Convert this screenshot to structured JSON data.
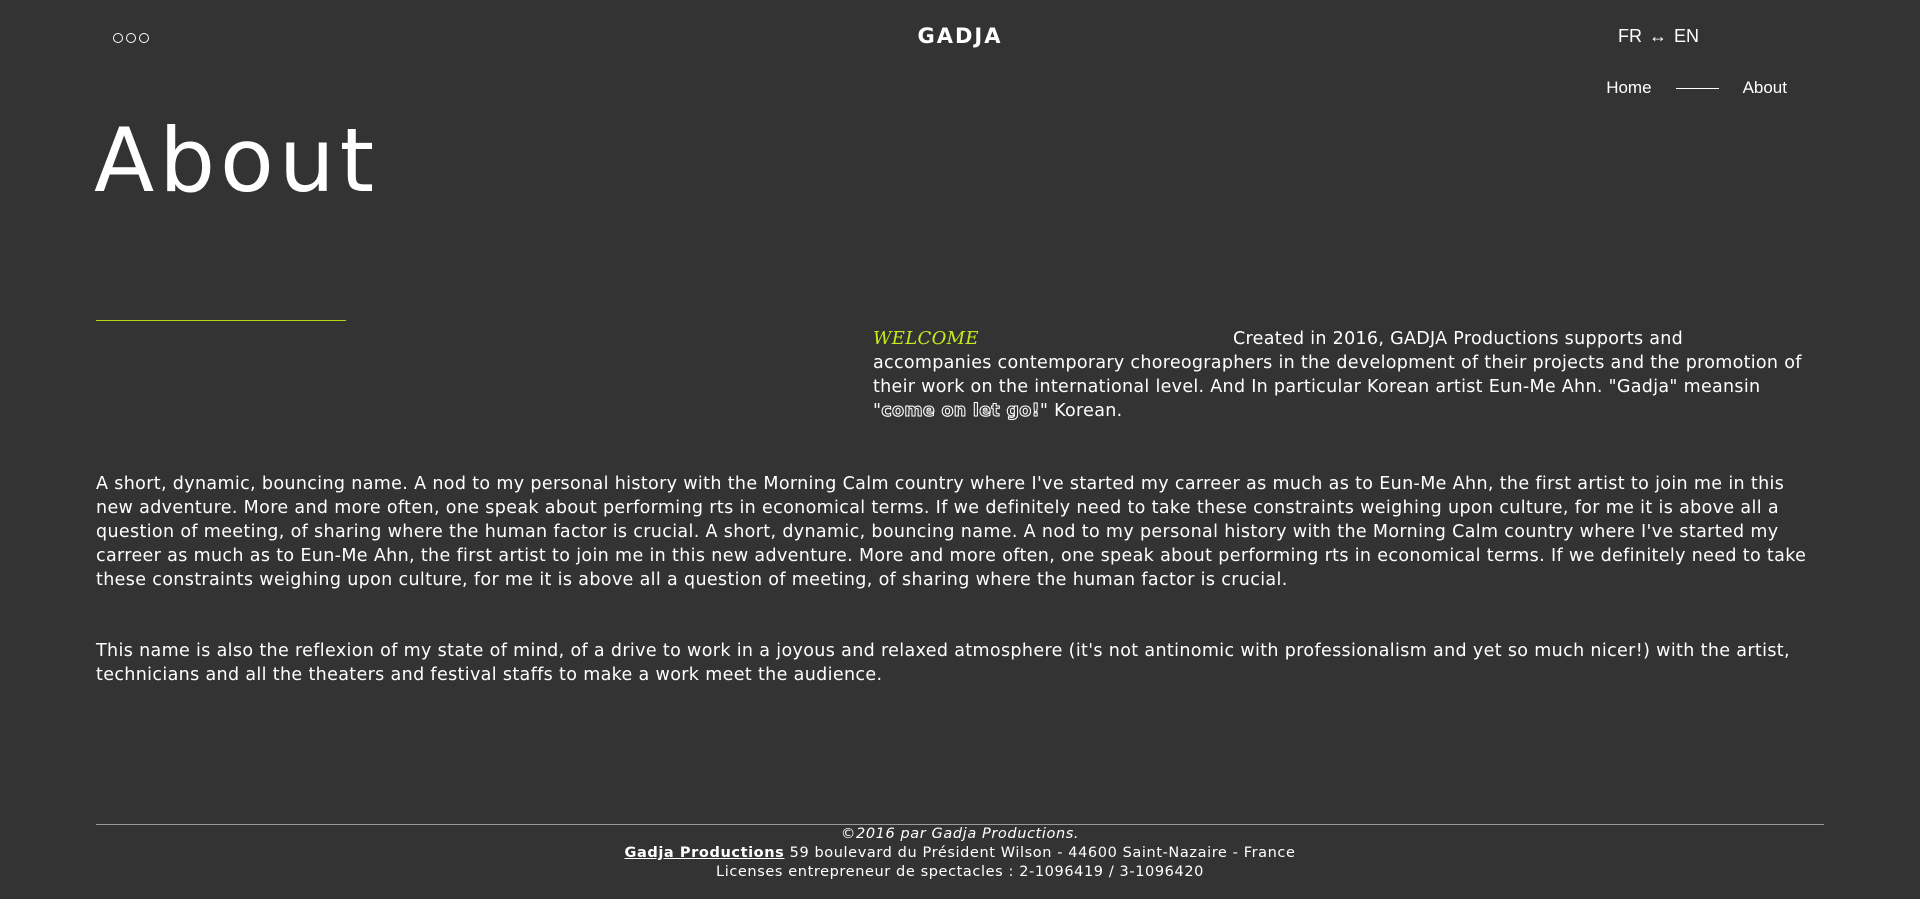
{
  "header": {
    "brand": "GADJA",
    "language": {
      "left": "FR",
      "arrow": "↔",
      "right": "EN"
    }
  },
  "subnav": {
    "home_label": "Home",
    "about_label": "About"
  },
  "page_title": "About",
  "intro": {
    "welcome": "WELCOME",
    "text_before": "Created in 2016, GADJA Productions supports and accompanies contemporary choreographers in the development of their projects and the promotion of their work on the international level. And In particular Korean artist Eun-Me Ahn. \"Gadja\" meansin \"",
    "outlined_phrase": "come on let go!",
    "text_after": "\" Korean."
  },
  "paragraphs": [
    "A short, dynamic, bouncing name. A nod to my personal history with the Morning Calm country where I've started my carreer as much as to Eun-Me Ahn, the first artist to join me in this new adventure. More and more often, one speak about performing rts in economical terms. If we definitely need to take these constraints weighing upon culture, for me it is above all a question of meeting, of sharing where the human factor is crucial. A short, dynamic, bouncing name. A nod to my personal history with the Morning Calm country where I've started my carreer as much as to Eun-Me Ahn, the first artist to join me in this new adventure. More and more often, one speak about performing rts in economical terms. If we definitely need to take these constraints weighing upon culture, for me it is above all a question of meeting, of sharing where the human factor is crucial.",
    "This name is also the reflexion of my state of mind, of a drive to work in a joyous and relaxed atmosphere (it's not antinomic with professionalism and yet so much nicer!) with the artist, technicians and all the theaters and festival staffs to make a work meet the audience."
  ],
  "footer": {
    "copyright": "©2016 par Gadja Productions.",
    "company_name": "Gadja Productions",
    "address": "59 boulevard du Président Wilson - 44600 Saint-Nazaire - France",
    "licenses": "Licenses entrepreneur de spectacles : 2-1096419 / 3-1096420"
  },
  "colors": {
    "background": "#333333",
    "text": "#ffffff",
    "accent": "#c4ec1c"
  },
  "icons": {
    "menu": "three-circles-menu-icon"
  }
}
